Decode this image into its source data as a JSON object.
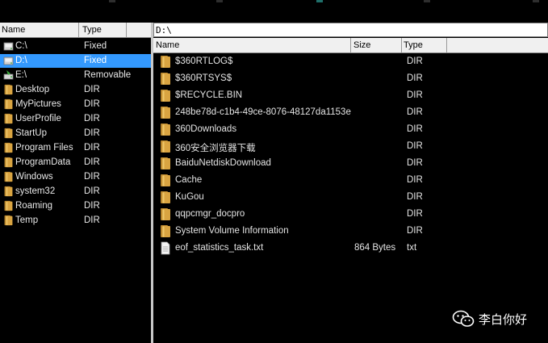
{
  "left_pane": {
    "headers": {
      "name": "Name",
      "type": "Type"
    },
    "items": [
      {
        "name": "C:\\",
        "type": "Fixed",
        "icon": "drive-icon",
        "selected": false
      },
      {
        "name": "D:\\",
        "type": "Fixed",
        "icon": "drive-icon",
        "selected": true
      },
      {
        "name": "E:\\",
        "type": "Removable",
        "icon": "removable-drive-icon",
        "selected": false
      },
      {
        "name": "Desktop",
        "type": "DIR",
        "icon": "folder-icon",
        "selected": false
      },
      {
        "name": "MyPictures",
        "type": "DIR",
        "icon": "folder-icon",
        "selected": false
      },
      {
        "name": "UserProfile",
        "type": "DIR",
        "icon": "folder-icon",
        "selected": false
      },
      {
        "name": "StartUp",
        "type": "DIR",
        "icon": "folder-icon",
        "selected": false
      },
      {
        "name": "Program Files",
        "type": "DIR",
        "icon": "folder-icon",
        "selected": false
      },
      {
        "name": "ProgramData",
        "type": "DIR",
        "icon": "folder-icon",
        "selected": false
      },
      {
        "name": "Windows",
        "type": "DIR",
        "icon": "folder-icon",
        "selected": false
      },
      {
        "name": "system32",
        "type": "DIR",
        "icon": "folder-icon",
        "selected": false
      },
      {
        "name": "Roaming",
        "type": "DIR",
        "icon": "folder-icon",
        "selected": false
      },
      {
        "name": "Temp",
        "type": "DIR",
        "icon": "folder-icon",
        "selected": false
      }
    ]
  },
  "right_pane": {
    "path": "D:\\",
    "headers": {
      "name": "Name",
      "size": "Size",
      "type": "Type"
    },
    "files": [
      {
        "name": "$360RTLOG$",
        "size": "",
        "type": "DIR",
        "icon": "folder-icon"
      },
      {
        "name": "$360RTSYS$",
        "size": "",
        "type": "DIR",
        "icon": "folder-icon"
      },
      {
        "name": "$RECYCLE.BIN",
        "size": "",
        "type": "DIR",
        "icon": "folder-icon"
      },
      {
        "name": "248be78d-c1b4-49ce-8076-48127da1153e",
        "size": "",
        "type": "DIR",
        "icon": "folder-icon"
      },
      {
        "name": "360Downloads",
        "size": "",
        "type": "DIR",
        "icon": "folder-icon"
      },
      {
        "name": "360安全浏览器下载",
        "size": "",
        "type": "DIR",
        "icon": "folder-icon"
      },
      {
        "name": "BaiduNetdiskDownload",
        "size": "",
        "type": "DIR",
        "icon": "folder-icon"
      },
      {
        "name": "Cache",
        "size": "",
        "type": "DIR",
        "icon": "folder-icon"
      },
      {
        "name": "KuGou",
        "size": "",
        "type": "DIR",
        "icon": "folder-icon"
      },
      {
        "name": "qqpcmgr_docpro",
        "size": "",
        "type": "DIR",
        "icon": "folder-icon"
      },
      {
        "name": "System Volume Information",
        "size": "",
        "type": "DIR",
        "icon": "folder-icon"
      },
      {
        "name": "eof_statistics_task.txt",
        "size": "864 Bytes",
        "type": "txt",
        "icon": "text-file-icon"
      }
    ]
  },
  "watermark": {
    "text": "李白你好",
    "icon": "wechat-icon"
  },
  "colors": {
    "selection": "#3399ff",
    "background": "#000000",
    "folder": "#d9a441"
  }
}
